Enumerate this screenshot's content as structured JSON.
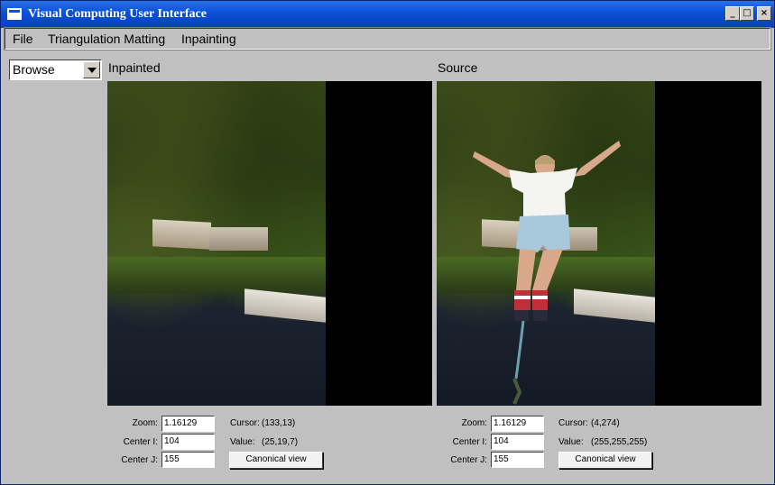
{
  "window": {
    "title": "Visual Computing User Interface"
  },
  "menu": [
    "File",
    "Triangulation Matting",
    "Inpainting"
  ],
  "mode_select": {
    "value": "Browse"
  },
  "panels": [
    {
      "label": "Inpainted",
      "zoom_label": "Zoom:",
      "zoom": "1.16129",
      "center_i_label": "Center I:",
      "center_i": "104",
      "center_j_label": "Center J:",
      "center_j": "155",
      "cursor_label": "Cursor:",
      "cursor": "(133,13)",
      "value_label": "Value:",
      "value": "(25,19,7)",
      "canonical_label": "Canonical view"
    },
    {
      "label": "Source",
      "zoom_label": "Zoom:",
      "zoom": "1.16129",
      "center_i_label": "Center I:",
      "center_i": "104",
      "center_j_label": "Center J:",
      "center_j": "155",
      "cursor_label": "Cursor:",
      "cursor": "(4,274)",
      "value_label": "Value:",
      "value": "(255,255,255)",
      "canonical_label": "Canonical view"
    }
  ],
  "colors": {
    "titlebar": "#0a4fd6",
    "face": "#c0c0c0",
    "image_bg": "#000000"
  }
}
